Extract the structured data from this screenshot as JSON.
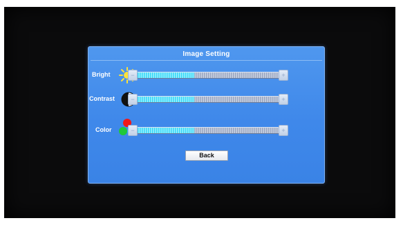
{
  "dialog": {
    "title": "Image Setting",
    "back_label": "Back",
    "colors": {
      "panel": "#3f88ea",
      "fill": "#37d8f6",
      "track": "#9aa6c0"
    }
  },
  "settings": [
    {
      "label": "Bright",
      "icon": "sun-icon",
      "level": 0.4,
      "minus": "−",
      "plus": "+"
    },
    {
      "label": "Contrast",
      "icon": "contrast-icon",
      "level": 0.4,
      "minus": "−",
      "plus": "+"
    },
    {
      "label": "Color",
      "icon": "rgb-dots-icon",
      "level": 0.4,
      "minus": "−",
      "plus": "+"
    }
  ]
}
